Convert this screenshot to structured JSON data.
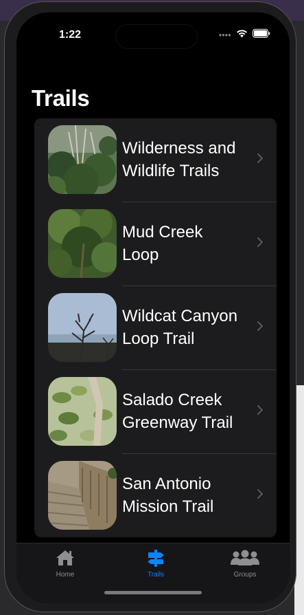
{
  "status_bar": {
    "time": "1:22"
  },
  "page": {
    "title": "Trails"
  },
  "trails": [
    {
      "line1": "Wilderness and",
      "line2": "Wildlife Trails"
    },
    {
      "line1": "Mud Creek",
      "line2": "Loop"
    },
    {
      "line1": "Wildcat Canyon",
      "line2": "Loop Trail"
    },
    {
      "line1": "Salado Creek",
      "line2": "Greenway Trail"
    },
    {
      "line1": "San Antonio",
      "line2": "Mission Trail"
    }
  ],
  "tab_bar": {
    "tabs": [
      {
        "label": "Home",
        "icon": "house-icon",
        "selected": false
      },
      {
        "label": "Trails",
        "icon": "signpost-icon",
        "selected": true
      },
      {
        "label": "Groups",
        "icon": "people-icon",
        "selected": false
      }
    ]
  },
  "colors": {
    "accent": "#0a84ff",
    "inactive_tab": "#8e8e93",
    "list_background": "#1c1c1e",
    "screen_background": "#000000"
  }
}
